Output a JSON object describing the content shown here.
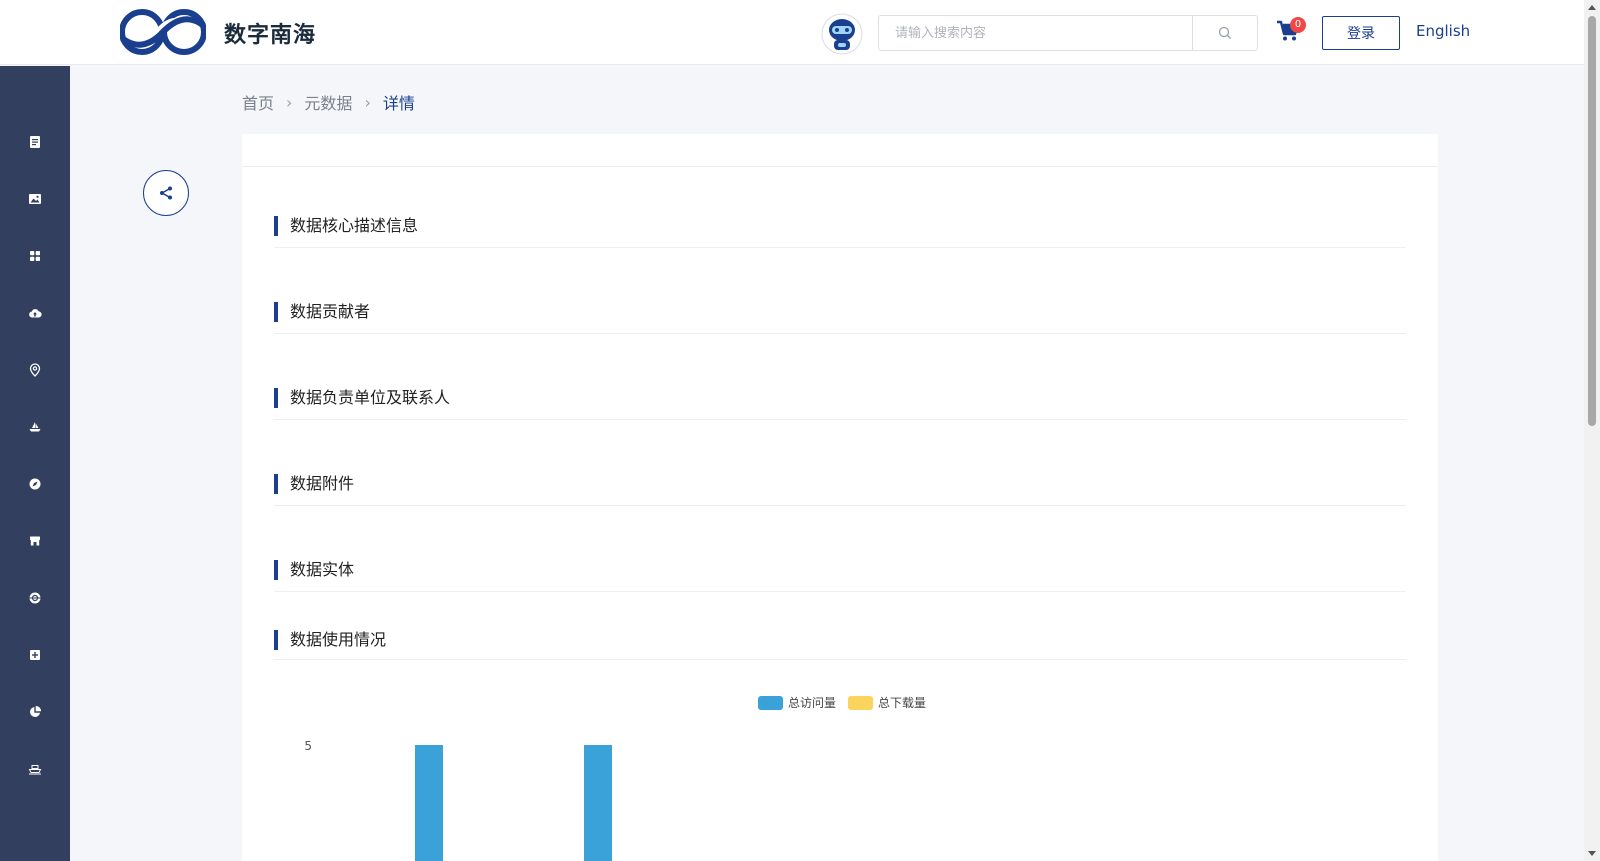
{
  "header": {
    "brand": "数字南海",
    "search_placeholder": "请输入搜索内容",
    "cart_count": "0",
    "login_label": "登录",
    "lang_label": "English"
  },
  "breadcrumb": [
    {
      "label": "首页"
    },
    {
      "label": "元数据"
    },
    {
      "label": "详情"
    }
  ],
  "sections": [
    {
      "title": "数据核心描述信息"
    },
    {
      "title": "数据贡献者"
    },
    {
      "title": "数据负责单位及联系人"
    },
    {
      "title": "数据附件"
    },
    {
      "title": "数据实体"
    },
    {
      "title": "数据使用情况"
    }
  ],
  "sidebar": {
    "icons": [
      "document-icon",
      "image-icon",
      "grid-icon",
      "cloud-upload-icon",
      "location-icon",
      "boat-icon",
      "compass-icon",
      "store-icon",
      "globe-icon",
      "add-box-icon",
      "pie-chart-icon",
      "ship-icon"
    ]
  },
  "colors": {
    "sidebar_bg": "#333f5e",
    "accent": "#1b3f8f",
    "visits": "#3aa1d9",
    "downloads": "#fbd45f"
  },
  "chart_data": {
    "type": "bar",
    "series": [
      {
        "name": "总访问量",
        "color": "#3aa1d9"
      },
      {
        "name": "总下载量",
        "color": "#fbd45f"
      }
    ],
    "y_ticks": [
      "5"
    ],
    "ylim_top": 5
  }
}
